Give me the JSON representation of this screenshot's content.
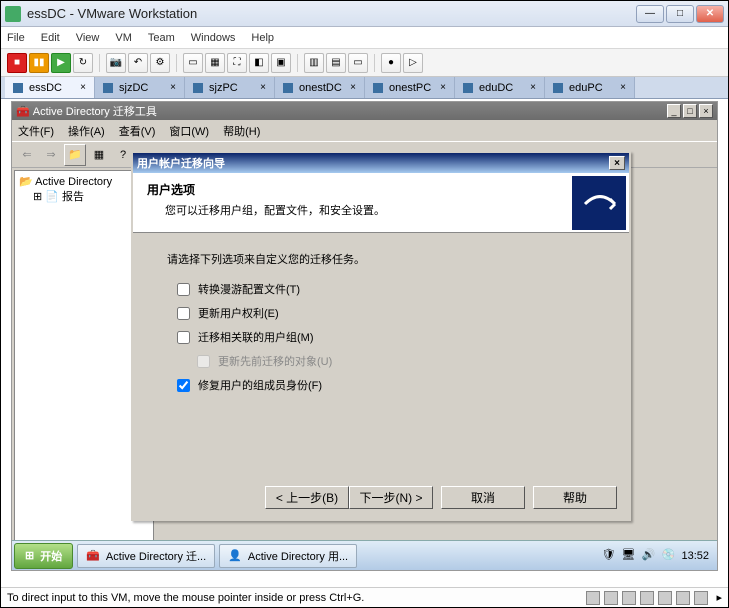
{
  "vmware": {
    "title": "essDC - VMware Workstation",
    "menus": [
      "File",
      "Edit",
      "View",
      "VM",
      "Team",
      "Windows",
      "Help"
    ],
    "tabs": [
      {
        "label": "essDC",
        "active": true
      },
      {
        "label": "sjzDC",
        "active": false
      },
      {
        "label": "sjzPC",
        "active": false
      },
      {
        "label": "onestDC",
        "active": false
      },
      {
        "label": "onestPC",
        "active": false
      },
      {
        "label": "eduDC",
        "active": false
      },
      {
        "label": "eduPC",
        "active": false
      }
    ],
    "status": "To direct input to this VM, move the mouse pointer inside or press Ctrl+G."
  },
  "admt": {
    "title": "Active Directory 迁移工具",
    "menus": [
      "文件(F)",
      "操作(A)",
      "查看(V)",
      "窗口(W)",
      "帮助(H)"
    ],
    "tree_root": "Active Directory",
    "tree_child": "报告"
  },
  "wizard": {
    "title": "用户帐户迁移向导",
    "header_title": "用户选项",
    "header_subtitle": "您可以迁移用户组，配置文件，和安全设置。",
    "prompt": "请选择下列选项来自定义您的迁移任务。",
    "checks": {
      "c1": "转换漫游配置文件(T)",
      "c2": "更新用户权利(E)",
      "c3": "迁移相关联的用户组(M)",
      "c4": "更新先前迁移的对象(U)",
      "c5": "修复用户的组成员身份(F)"
    },
    "buttons": {
      "back": "< 上一步(B)",
      "next": "下一步(N) >",
      "cancel": "取消",
      "help": "帮助"
    }
  },
  "guest_taskbar": {
    "start": "开始",
    "task1": "Active Directory 迁...",
    "task2": "Active Directory 用...",
    "clock": "13:52"
  }
}
